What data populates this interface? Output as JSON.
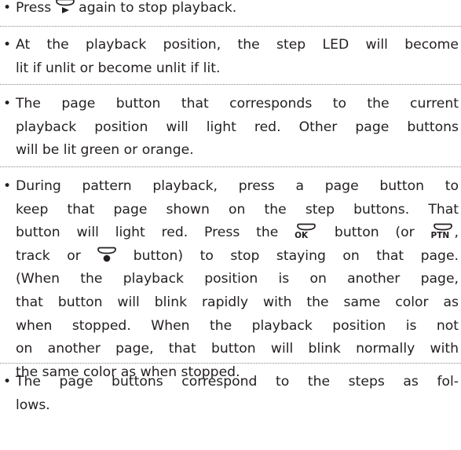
{
  "bullet": "•",
  "items": [
    {
      "lines": [
        [
          "Press ",
          {
            "icon": "play-key-icon"
          },
          " again to stop playback."
        ]
      ]
    },
    {
      "lines": [
        [
          "At the playback position, the step LED will become"
        ],
        [
          "lit if unlit or become unlit if lit."
        ]
      ]
    },
    {
      "lines": [
        [
          "The page button that corresponds to the current"
        ],
        [
          "playback position will light red. Other page buttons"
        ],
        [
          "will be lit green or orange."
        ]
      ]
    },
    {
      "lines": [
        [
          "During pattern playback, press a page button to"
        ],
        [
          "keep that page shown on the step buttons. That"
        ],
        [
          "button will light red. Press the ",
          {
            "icon": "ok-key-icon",
            "label": "OK"
          },
          " button (or ",
          {
            "icon": "ptn-key-icon",
            "label": "PTN"
          },
          ","
        ],
        [
          "track or ",
          {
            "icon": "rec-key-icon"
          },
          " button) to stop staying on that page."
        ],
        [
          "(When the playback position is on another page,"
        ],
        [
          "that button will blink rapidly with the same color as"
        ],
        [
          "when stopped. When the playback position is not"
        ],
        [
          "on another page, that button will blink normally with"
        ],
        [
          "the same color as when stopped."
        ]
      ]
    },
    {
      "lines": [
        [
          "The page buttons correspond to the steps as fol-"
        ],
        [
          "lows."
        ]
      ]
    }
  ],
  "colors": {
    "text": "#231f20",
    "divider": "#8a8a8a"
  }
}
